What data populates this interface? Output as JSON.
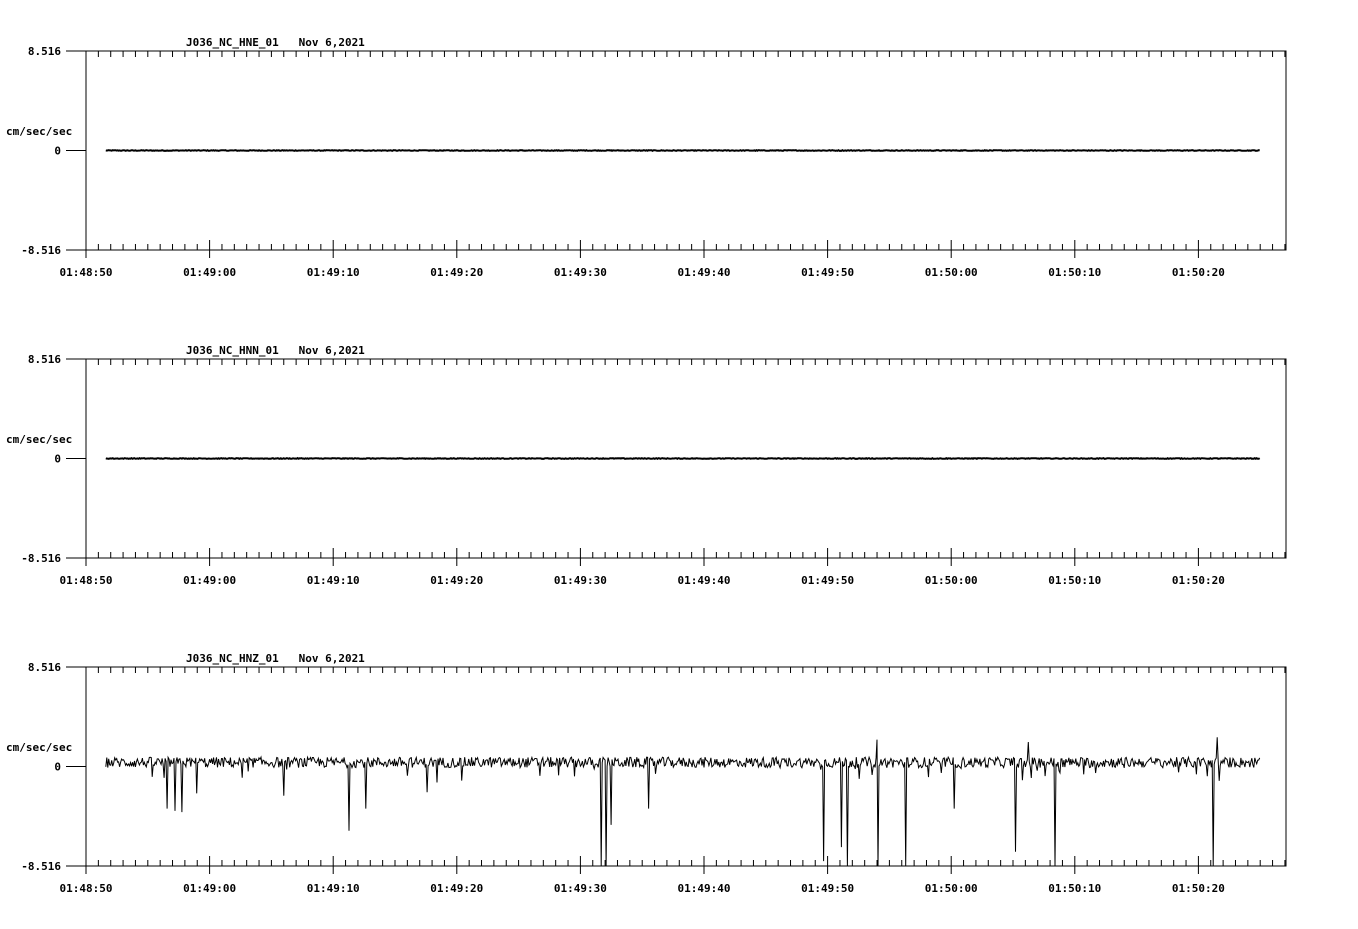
{
  "chart_data": [
    {
      "type": "line",
      "title": "J036_NC_HNE_01   Nov 6,2021",
      "ylabel": "cm/sec/sec",
      "ylim": [
        -8.516,
        8.516
      ],
      "y_tick_labels": [
        "8.516",
        "0",
        "-8.516"
      ],
      "x_tick_labels": [
        "01:48:50",
        "01:49:00",
        "01:49:10",
        "01:49:20",
        "01:49:30",
        "01:49:40",
        "01:49:50",
        "01:50:00",
        "01:50:10",
        "01:50:20"
      ],
      "xlim_seconds": [
        0,
        97
      ],
      "signal": {
        "start_s": 1.6,
        "end_s": 95.0,
        "baseline": 0.0,
        "noise": 0.03,
        "negative_spikes": []
      }
    },
    {
      "type": "line",
      "title": "J036_NC_HNN_01   Nov 6,2021",
      "ylabel": "cm/sec/sec",
      "ylim": [
        -8.516,
        8.516
      ],
      "y_tick_labels": [
        "8.516",
        "0",
        "-8.516"
      ],
      "x_tick_labels": [
        "01:48:50",
        "01:49:00",
        "01:49:10",
        "01:49:20",
        "01:49:30",
        "01:49:40",
        "01:49:50",
        "01:50:00",
        "01:50:10",
        "01:50:20"
      ],
      "xlim_seconds": [
        0,
        97
      ],
      "signal": {
        "start_s": 1.6,
        "end_s": 95.0,
        "baseline": 0.0,
        "noise": 0.03,
        "negative_spikes": []
      }
    },
    {
      "type": "line",
      "title": "J036_NC_HNZ_01   Nov 6,2021",
      "ylabel": "cm/sec/sec",
      "ylim": [
        -8.516,
        8.516
      ],
      "y_tick_labels": [
        "8.516",
        "0",
        "-8.516"
      ],
      "x_tick_labels": [
        "01:48:50",
        "01:49:00",
        "01:49:10",
        "01:49:20",
        "01:49:30",
        "01:49:40",
        "01:49:50",
        "01:50:00",
        "01:50:10",
        "01:50:20"
      ],
      "xlim_seconds": [
        0,
        97
      ],
      "signal": {
        "start_s": 1.6,
        "end_s": 95.0,
        "baseline": 0.35,
        "noise": 0.45,
        "negative_spikes": [
          [
            6.6,
            -3.6
          ],
          [
            7.2,
            -3.8
          ],
          [
            7.8,
            -3.9
          ],
          [
            9.0,
            -2.3
          ],
          [
            16.0,
            -2.5
          ],
          [
            21.3,
            -5.5
          ],
          [
            22.6,
            -3.6
          ],
          [
            27.6,
            -2.2
          ],
          [
            41.7,
            -15.8
          ],
          [
            42.1,
            -16.3
          ],
          [
            42.5,
            -5.0
          ],
          [
            45.5,
            -3.6
          ],
          [
            59.7,
            -8.1
          ],
          [
            61.1,
            -6.9
          ],
          [
            61.6,
            -9.5
          ],
          [
            64.1,
            -8.6
          ],
          [
            66.3,
            -11.5
          ],
          [
            70.2,
            -3.6
          ],
          [
            75.2,
            -7.3
          ],
          [
            76.2,
            -8.1
          ],
          [
            78.4,
            -8.6
          ],
          [
            91.2,
            -10.9
          ]
        ],
        "positive_spikes": [
          [
            64.0,
            2.3
          ],
          [
            76.2,
            2.1
          ],
          [
            91.5,
            2.5
          ]
        ]
      }
    }
  ]
}
